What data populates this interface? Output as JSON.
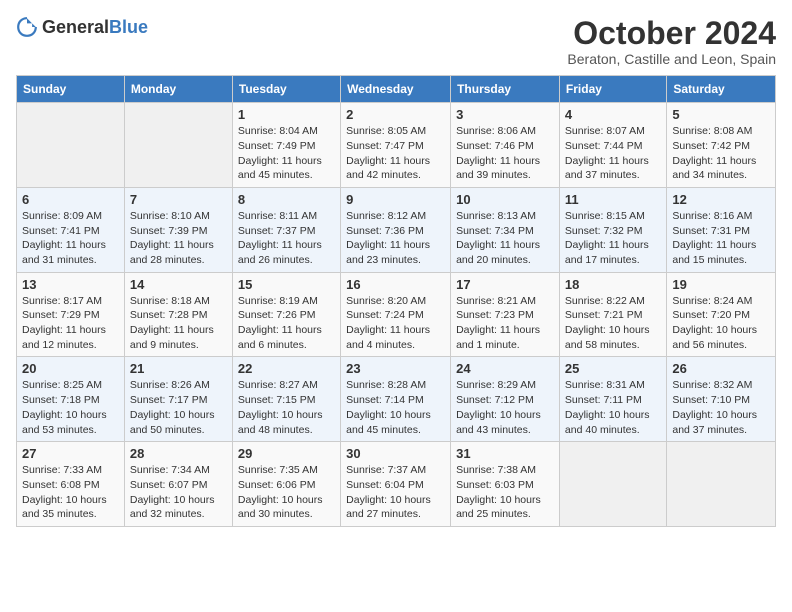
{
  "header": {
    "logo_general": "General",
    "logo_blue": "Blue",
    "month": "October 2024",
    "location": "Beraton, Castille and Leon, Spain"
  },
  "days_of_week": [
    "Sunday",
    "Monday",
    "Tuesday",
    "Wednesday",
    "Thursday",
    "Friday",
    "Saturday"
  ],
  "weeks": [
    [
      {
        "day": "",
        "info": ""
      },
      {
        "day": "",
        "info": ""
      },
      {
        "day": "1",
        "info": "Sunrise: 8:04 AM\nSunset: 7:49 PM\nDaylight: 11 hours and 45 minutes."
      },
      {
        "day": "2",
        "info": "Sunrise: 8:05 AM\nSunset: 7:47 PM\nDaylight: 11 hours and 42 minutes."
      },
      {
        "day": "3",
        "info": "Sunrise: 8:06 AM\nSunset: 7:46 PM\nDaylight: 11 hours and 39 minutes."
      },
      {
        "day": "4",
        "info": "Sunrise: 8:07 AM\nSunset: 7:44 PM\nDaylight: 11 hours and 37 minutes."
      },
      {
        "day": "5",
        "info": "Sunrise: 8:08 AM\nSunset: 7:42 PM\nDaylight: 11 hours and 34 minutes."
      }
    ],
    [
      {
        "day": "6",
        "info": "Sunrise: 8:09 AM\nSunset: 7:41 PM\nDaylight: 11 hours and 31 minutes."
      },
      {
        "day": "7",
        "info": "Sunrise: 8:10 AM\nSunset: 7:39 PM\nDaylight: 11 hours and 28 minutes."
      },
      {
        "day": "8",
        "info": "Sunrise: 8:11 AM\nSunset: 7:37 PM\nDaylight: 11 hours and 26 minutes."
      },
      {
        "day": "9",
        "info": "Sunrise: 8:12 AM\nSunset: 7:36 PM\nDaylight: 11 hours and 23 minutes."
      },
      {
        "day": "10",
        "info": "Sunrise: 8:13 AM\nSunset: 7:34 PM\nDaylight: 11 hours and 20 minutes."
      },
      {
        "day": "11",
        "info": "Sunrise: 8:15 AM\nSunset: 7:32 PM\nDaylight: 11 hours and 17 minutes."
      },
      {
        "day": "12",
        "info": "Sunrise: 8:16 AM\nSunset: 7:31 PM\nDaylight: 11 hours and 15 minutes."
      }
    ],
    [
      {
        "day": "13",
        "info": "Sunrise: 8:17 AM\nSunset: 7:29 PM\nDaylight: 11 hours and 12 minutes."
      },
      {
        "day": "14",
        "info": "Sunrise: 8:18 AM\nSunset: 7:28 PM\nDaylight: 11 hours and 9 minutes."
      },
      {
        "day": "15",
        "info": "Sunrise: 8:19 AM\nSunset: 7:26 PM\nDaylight: 11 hours and 6 minutes."
      },
      {
        "day": "16",
        "info": "Sunrise: 8:20 AM\nSunset: 7:24 PM\nDaylight: 11 hours and 4 minutes."
      },
      {
        "day": "17",
        "info": "Sunrise: 8:21 AM\nSunset: 7:23 PM\nDaylight: 11 hours and 1 minute."
      },
      {
        "day": "18",
        "info": "Sunrise: 8:22 AM\nSunset: 7:21 PM\nDaylight: 10 hours and 58 minutes."
      },
      {
        "day": "19",
        "info": "Sunrise: 8:24 AM\nSunset: 7:20 PM\nDaylight: 10 hours and 56 minutes."
      }
    ],
    [
      {
        "day": "20",
        "info": "Sunrise: 8:25 AM\nSunset: 7:18 PM\nDaylight: 10 hours and 53 minutes."
      },
      {
        "day": "21",
        "info": "Sunrise: 8:26 AM\nSunset: 7:17 PM\nDaylight: 10 hours and 50 minutes."
      },
      {
        "day": "22",
        "info": "Sunrise: 8:27 AM\nSunset: 7:15 PM\nDaylight: 10 hours and 48 minutes."
      },
      {
        "day": "23",
        "info": "Sunrise: 8:28 AM\nSunset: 7:14 PM\nDaylight: 10 hours and 45 minutes."
      },
      {
        "day": "24",
        "info": "Sunrise: 8:29 AM\nSunset: 7:12 PM\nDaylight: 10 hours and 43 minutes."
      },
      {
        "day": "25",
        "info": "Sunrise: 8:31 AM\nSunset: 7:11 PM\nDaylight: 10 hours and 40 minutes."
      },
      {
        "day": "26",
        "info": "Sunrise: 8:32 AM\nSunset: 7:10 PM\nDaylight: 10 hours and 37 minutes."
      }
    ],
    [
      {
        "day": "27",
        "info": "Sunrise: 7:33 AM\nSunset: 6:08 PM\nDaylight: 10 hours and 35 minutes."
      },
      {
        "day": "28",
        "info": "Sunrise: 7:34 AM\nSunset: 6:07 PM\nDaylight: 10 hours and 32 minutes."
      },
      {
        "day": "29",
        "info": "Sunrise: 7:35 AM\nSunset: 6:06 PM\nDaylight: 10 hours and 30 minutes."
      },
      {
        "day": "30",
        "info": "Sunrise: 7:37 AM\nSunset: 6:04 PM\nDaylight: 10 hours and 27 minutes."
      },
      {
        "day": "31",
        "info": "Sunrise: 7:38 AM\nSunset: 6:03 PM\nDaylight: 10 hours and 25 minutes."
      },
      {
        "day": "",
        "info": ""
      },
      {
        "day": "",
        "info": ""
      }
    ]
  ]
}
